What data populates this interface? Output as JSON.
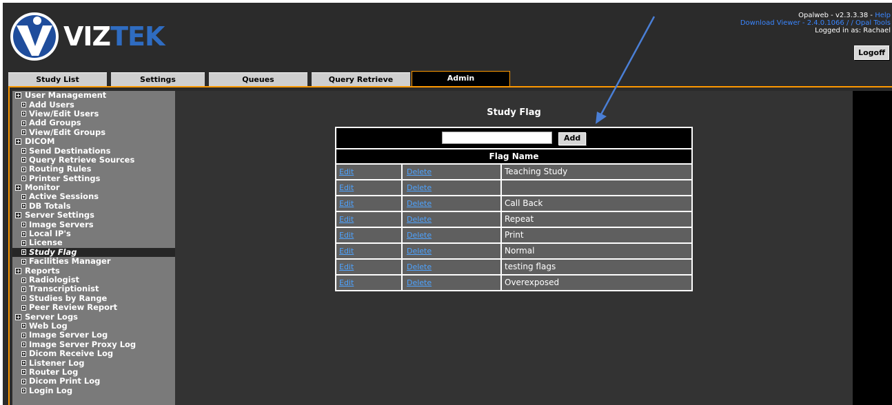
{
  "header": {
    "logo_text_1": "VIZ",
    "logo_text_2": "TEK",
    "app_version": "Opalweb - v2.3.3.38 - ",
    "help_link": "Help",
    "download_viewer": "Download Viewer - 2.4.0.1066 / ",
    "opal_tools": "/ Opal Tools",
    "logged_in": "Logged in as: Rachael",
    "logoff_label": "Logoff"
  },
  "tabs": [
    {
      "label": "Study List"
    },
    {
      "label": "Settings"
    },
    {
      "label": "Queues"
    },
    {
      "label": "Query Retrieve"
    },
    {
      "label": "Admin",
      "active": true
    }
  ],
  "sidebar": {
    "items": [
      {
        "label": "User Management",
        "level": "section"
      },
      {
        "label": "Add Users",
        "level": "sub"
      },
      {
        "label": "View/Edit Users",
        "level": "sub"
      },
      {
        "label": "Add Groups",
        "level": "sub"
      },
      {
        "label": "View/Edit Groups",
        "level": "sub"
      },
      {
        "label": "DICOM",
        "level": "section"
      },
      {
        "label": "Send Destinations",
        "level": "sub"
      },
      {
        "label": "Query Retrieve Sources",
        "level": "sub"
      },
      {
        "label": "Routing Rules",
        "level": "sub"
      },
      {
        "label": "Printer Settings",
        "level": "sub"
      },
      {
        "label": "Monitor",
        "level": "section"
      },
      {
        "label": "Active Sessions",
        "level": "sub"
      },
      {
        "label": "DB Totals",
        "level": "sub"
      },
      {
        "label": "Server Settings",
        "level": "section"
      },
      {
        "label": "Image Servers",
        "level": "sub"
      },
      {
        "label": "Local IP's",
        "level": "sub"
      },
      {
        "label": "License",
        "level": "sub"
      },
      {
        "label": "Study Flag",
        "level": "sub",
        "current": true
      },
      {
        "label": "Facilities Manager",
        "level": "sub"
      },
      {
        "label": "Reports",
        "level": "section"
      },
      {
        "label": "Radiologist",
        "level": "sub"
      },
      {
        "label": "Transcriptionist",
        "level": "sub"
      },
      {
        "label": "Studies by Range",
        "level": "sub"
      },
      {
        "label": "Peer Review Report",
        "level": "sub"
      },
      {
        "label": "Server Logs",
        "level": "section"
      },
      {
        "label": "Web Log",
        "level": "sub"
      },
      {
        "label": "Image Server Log",
        "level": "sub"
      },
      {
        "label": "Image Server Proxy Log",
        "level": "sub"
      },
      {
        "label": "Dicom Receive Log",
        "level": "sub"
      },
      {
        "label": "Listener Log",
        "level": "sub"
      },
      {
        "label": "Router Log",
        "level": "sub"
      },
      {
        "label": "Dicom Print Log",
        "level": "sub"
      },
      {
        "label": "Login Log",
        "level": "sub"
      }
    ]
  },
  "main": {
    "title": "Study Flag",
    "input_value": "",
    "add_label": "Add",
    "column_header": "Flag Name",
    "edit_label": "Edit",
    "delete_label": "Delete",
    "flags": [
      "Teaching Study",
      "",
      "Call Back",
      "Repeat",
      "Print",
      "Normal",
      "testing flags",
      "Overexposed"
    ]
  },
  "colors": {
    "background": "#2b2b2b",
    "accent_orange": "#ff9900",
    "link_blue": "#4ea3ff",
    "annotation_arrow": "#4a7fd6"
  }
}
